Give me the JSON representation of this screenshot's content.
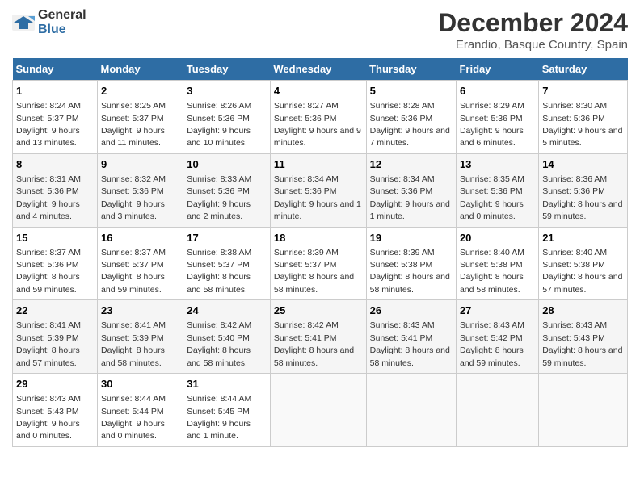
{
  "logo": {
    "general": "General",
    "blue": "Blue"
  },
  "title": "December 2024",
  "subtitle": "Erandio, Basque Country, Spain",
  "days_header": [
    "Sunday",
    "Monday",
    "Tuesday",
    "Wednesday",
    "Thursday",
    "Friday",
    "Saturday"
  ],
  "weeks": [
    [
      {
        "day": "1",
        "sunrise": "Sunrise: 8:24 AM",
        "sunset": "Sunset: 5:37 PM",
        "daylight": "Daylight: 9 hours and 13 minutes."
      },
      {
        "day": "2",
        "sunrise": "Sunrise: 8:25 AM",
        "sunset": "Sunset: 5:37 PM",
        "daylight": "Daylight: 9 hours and 11 minutes."
      },
      {
        "day": "3",
        "sunrise": "Sunrise: 8:26 AM",
        "sunset": "Sunset: 5:36 PM",
        "daylight": "Daylight: 9 hours and 10 minutes."
      },
      {
        "day": "4",
        "sunrise": "Sunrise: 8:27 AM",
        "sunset": "Sunset: 5:36 PM",
        "daylight": "Daylight: 9 hours and 9 minutes."
      },
      {
        "day": "5",
        "sunrise": "Sunrise: 8:28 AM",
        "sunset": "Sunset: 5:36 PM",
        "daylight": "Daylight: 9 hours and 7 minutes."
      },
      {
        "day": "6",
        "sunrise": "Sunrise: 8:29 AM",
        "sunset": "Sunset: 5:36 PM",
        "daylight": "Daylight: 9 hours and 6 minutes."
      },
      {
        "day": "7",
        "sunrise": "Sunrise: 8:30 AM",
        "sunset": "Sunset: 5:36 PM",
        "daylight": "Daylight: 9 hours and 5 minutes."
      }
    ],
    [
      {
        "day": "8",
        "sunrise": "Sunrise: 8:31 AM",
        "sunset": "Sunset: 5:36 PM",
        "daylight": "Daylight: 9 hours and 4 minutes."
      },
      {
        "day": "9",
        "sunrise": "Sunrise: 8:32 AM",
        "sunset": "Sunset: 5:36 PM",
        "daylight": "Daylight: 9 hours and 3 minutes."
      },
      {
        "day": "10",
        "sunrise": "Sunrise: 8:33 AM",
        "sunset": "Sunset: 5:36 PM",
        "daylight": "Daylight: 9 hours and 2 minutes."
      },
      {
        "day": "11",
        "sunrise": "Sunrise: 8:34 AM",
        "sunset": "Sunset: 5:36 PM",
        "daylight": "Daylight: 9 hours and 1 minute."
      },
      {
        "day": "12",
        "sunrise": "Sunrise: 8:34 AM",
        "sunset": "Sunset: 5:36 PM",
        "daylight": "Daylight: 9 hours and 1 minute."
      },
      {
        "day": "13",
        "sunrise": "Sunrise: 8:35 AM",
        "sunset": "Sunset: 5:36 PM",
        "daylight": "Daylight: 9 hours and 0 minutes."
      },
      {
        "day": "14",
        "sunrise": "Sunrise: 8:36 AM",
        "sunset": "Sunset: 5:36 PM",
        "daylight": "Daylight: 8 hours and 59 minutes."
      }
    ],
    [
      {
        "day": "15",
        "sunrise": "Sunrise: 8:37 AM",
        "sunset": "Sunset: 5:36 PM",
        "daylight": "Daylight: 8 hours and 59 minutes."
      },
      {
        "day": "16",
        "sunrise": "Sunrise: 8:37 AM",
        "sunset": "Sunset: 5:37 PM",
        "daylight": "Daylight: 8 hours and 59 minutes."
      },
      {
        "day": "17",
        "sunrise": "Sunrise: 8:38 AM",
        "sunset": "Sunset: 5:37 PM",
        "daylight": "Daylight: 8 hours and 58 minutes."
      },
      {
        "day": "18",
        "sunrise": "Sunrise: 8:39 AM",
        "sunset": "Sunset: 5:37 PM",
        "daylight": "Daylight: 8 hours and 58 minutes."
      },
      {
        "day": "19",
        "sunrise": "Sunrise: 8:39 AM",
        "sunset": "Sunset: 5:38 PM",
        "daylight": "Daylight: 8 hours and 58 minutes."
      },
      {
        "day": "20",
        "sunrise": "Sunrise: 8:40 AM",
        "sunset": "Sunset: 5:38 PM",
        "daylight": "Daylight: 8 hours and 58 minutes."
      },
      {
        "day": "21",
        "sunrise": "Sunrise: 8:40 AM",
        "sunset": "Sunset: 5:38 PM",
        "daylight": "Daylight: 8 hours and 57 minutes."
      }
    ],
    [
      {
        "day": "22",
        "sunrise": "Sunrise: 8:41 AM",
        "sunset": "Sunset: 5:39 PM",
        "daylight": "Daylight: 8 hours and 57 minutes."
      },
      {
        "day": "23",
        "sunrise": "Sunrise: 8:41 AM",
        "sunset": "Sunset: 5:39 PM",
        "daylight": "Daylight: 8 hours and 58 minutes."
      },
      {
        "day": "24",
        "sunrise": "Sunrise: 8:42 AM",
        "sunset": "Sunset: 5:40 PM",
        "daylight": "Daylight: 8 hours and 58 minutes."
      },
      {
        "day": "25",
        "sunrise": "Sunrise: 8:42 AM",
        "sunset": "Sunset: 5:41 PM",
        "daylight": "Daylight: 8 hours and 58 minutes."
      },
      {
        "day": "26",
        "sunrise": "Sunrise: 8:43 AM",
        "sunset": "Sunset: 5:41 PM",
        "daylight": "Daylight: 8 hours and 58 minutes."
      },
      {
        "day": "27",
        "sunrise": "Sunrise: 8:43 AM",
        "sunset": "Sunset: 5:42 PM",
        "daylight": "Daylight: 8 hours and 59 minutes."
      },
      {
        "day": "28",
        "sunrise": "Sunrise: 8:43 AM",
        "sunset": "Sunset: 5:43 PM",
        "daylight": "Daylight: 8 hours and 59 minutes."
      }
    ],
    [
      {
        "day": "29",
        "sunrise": "Sunrise: 8:43 AM",
        "sunset": "Sunset: 5:43 PM",
        "daylight": "Daylight: 9 hours and 0 minutes."
      },
      {
        "day": "30",
        "sunrise": "Sunrise: 8:44 AM",
        "sunset": "Sunset: 5:44 PM",
        "daylight": "Daylight: 9 hours and 0 minutes."
      },
      {
        "day": "31",
        "sunrise": "Sunrise: 8:44 AM",
        "sunset": "Sunset: 5:45 PM",
        "daylight": "Daylight: 9 hours and 1 minute."
      },
      null,
      null,
      null,
      null
    ]
  ]
}
